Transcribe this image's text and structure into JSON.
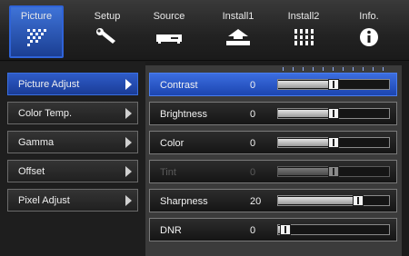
{
  "tabs": [
    {
      "label": "Picture",
      "icon": "picture-grid-icon"
    },
    {
      "label": "Setup",
      "icon": "wrench-icon"
    },
    {
      "label": "Source",
      "icon": "source-device-icon"
    },
    {
      "label": "Install1",
      "icon": "install-arrow-icon"
    },
    {
      "label": "Install2",
      "icon": "install-grid-icon"
    },
    {
      "label": "Info.",
      "icon": "info-icon"
    }
  ],
  "left_menu": [
    {
      "label": "Picture Adjust"
    },
    {
      "label": "Color Temp."
    },
    {
      "label": "Gamma"
    },
    {
      "label": "Offset"
    },
    {
      "label": "Pixel Adjust"
    }
  ],
  "settings": [
    {
      "label": "Contrast",
      "value": "0",
      "level": 0.5
    },
    {
      "label": "Brightness",
      "value": "0",
      "level": 0.5
    },
    {
      "label": "Color",
      "value": "0",
      "level": 0.5
    },
    {
      "label": "Tint",
      "value": "0",
      "level": 0.5
    },
    {
      "label": "Sharpness",
      "value": "20",
      "level": 0.75
    },
    {
      "label": "DNR",
      "value": "0",
      "level": 0.0
    }
  ],
  "colors": {
    "accent": "#2f63d8",
    "panel": "#3b3b3b"
  }
}
